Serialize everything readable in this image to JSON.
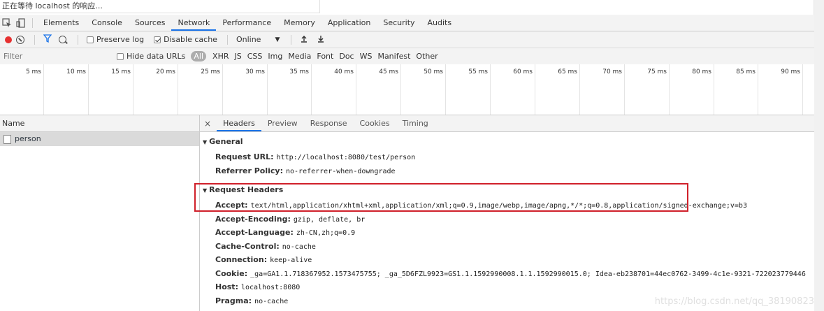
{
  "status": {
    "text": "正在等待 localhost 的响应..."
  },
  "devtools": {
    "tabs": [
      {
        "label": "Elements"
      },
      {
        "label": "Console"
      },
      {
        "label": "Sources"
      },
      {
        "label": "Network"
      },
      {
        "label": "Performance"
      },
      {
        "label": "Memory"
      },
      {
        "label": "Application"
      },
      {
        "label": "Security"
      },
      {
        "label": "Audits"
      }
    ],
    "active_tab": "Network"
  },
  "controls": {
    "preserve_log": "Preserve log",
    "disable_cache": "Disable cache",
    "throttle": "Online"
  },
  "filter": {
    "placeholder": "Filter",
    "hide_data_urls": "Hide data URLs",
    "types": [
      "All",
      "XHR",
      "JS",
      "CSS",
      "Img",
      "Media",
      "Font",
      "Doc",
      "WS",
      "Manifest",
      "Other"
    ]
  },
  "timeline": {
    "ticks": [
      "5 ms",
      "10 ms",
      "15 ms",
      "20 ms",
      "25 ms",
      "30 ms",
      "35 ms",
      "40 ms",
      "45 ms",
      "50 ms",
      "55 ms",
      "60 ms",
      "65 ms",
      "70 ms",
      "75 ms",
      "80 ms",
      "85 ms",
      "90 ms"
    ]
  },
  "requests": {
    "header": "Name",
    "items": [
      {
        "name": "person"
      }
    ]
  },
  "details": {
    "close": "×",
    "tabs": [
      "Headers",
      "Preview",
      "Response",
      "Cookies",
      "Timing"
    ],
    "active_tab": "Headers",
    "general": {
      "title": "General",
      "rows": [
        {
          "key": "Request URL:",
          "value": "http://localhost:8080/test/person"
        },
        {
          "key": "Referrer Policy:",
          "value": "no-referrer-when-downgrade"
        }
      ]
    },
    "request_headers": {
      "title": "Request Headers",
      "rows": [
        {
          "key": "Accept:",
          "value": "text/html,application/xhtml+xml,application/xml;q=0.9,image/webp,image/apng,*/*;q=0.8,application/signed-exchange;v=b3"
        },
        {
          "key": "Accept-Encoding:",
          "value": "gzip, deflate, br"
        },
        {
          "key": "Accept-Language:",
          "value": "zh-CN,zh;q=0.9"
        },
        {
          "key": "Cache-Control:",
          "value": "no-cache"
        },
        {
          "key": "Connection:",
          "value": "keep-alive"
        },
        {
          "key": "Cookie:",
          "value": "_ga=GA1.1.718367952.1573475755; _ga_5D6FZL9923=GS1.1.1592990008.1.1.1592990015.0; Idea-eb238701=44ec0762-3499-4c1e-9321-722023779446"
        },
        {
          "key": "Host:",
          "value": "localhost:8080"
        },
        {
          "key": "Pragma:",
          "value": "no-cache"
        }
      ]
    }
  },
  "watermark": "https://blog.csdn.net/qq_38190823"
}
